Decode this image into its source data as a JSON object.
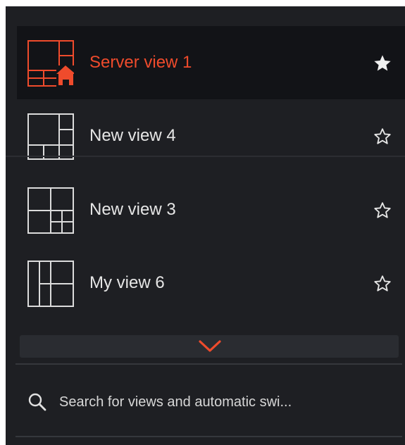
{
  "views": [
    {
      "label": "Server view 1",
      "icon": "server-view-layout-icon",
      "starred": true,
      "active": true
    },
    {
      "label": "New view 4",
      "icon": "view-layout-icon",
      "starred": false,
      "active": false
    },
    {
      "label": "New view 3",
      "icon": "view-layout-icon",
      "starred": false,
      "active": false
    },
    {
      "label": "My view 6",
      "icon": "view-layout-icon",
      "starred": false,
      "active": false
    }
  ],
  "expand": {
    "icon": "chevron-down-icon"
  },
  "search": {
    "placeholder": "Search for views and automatic swi...",
    "icon": "search-icon"
  },
  "colors": {
    "accent": "#ef4b2c",
    "panel_bg": "#1e1f23",
    "active_bg": "#121317",
    "text": "#e6e6e6"
  }
}
